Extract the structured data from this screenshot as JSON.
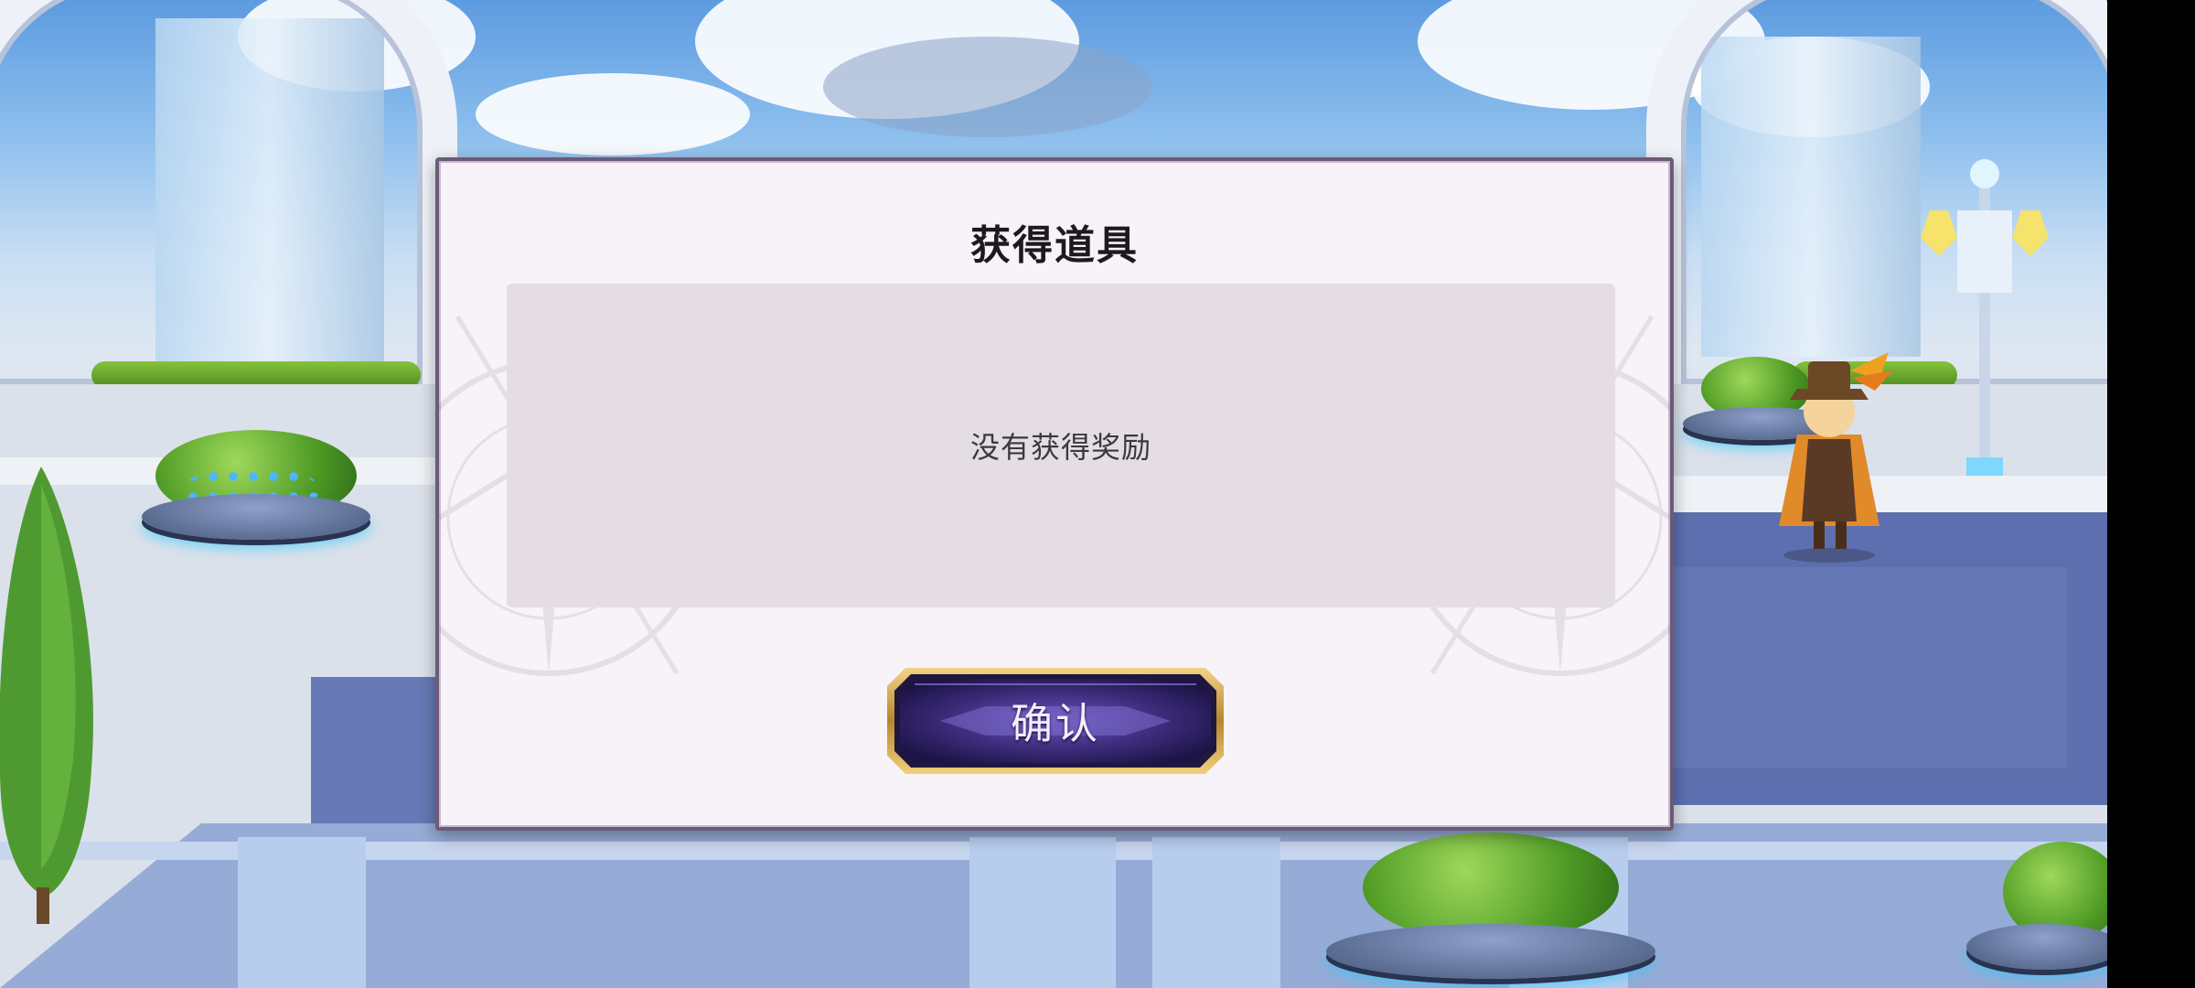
{
  "dialog": {
    "title": "获得道具",
    "empty_message": "没有获得奖励",
    "confirm_label": "确认"
  },
  "colors": {
    "panel_bg": "#f7f3f8",
    "panel_border": "#6d5a78",
    "reward_area_bg": "#e4dde3",
    "button_fill": "#3a2a78",
    "button_frame": "#c9a24a"
  },
  "icons": [
    "confirm-button-frame"
  ]
}
